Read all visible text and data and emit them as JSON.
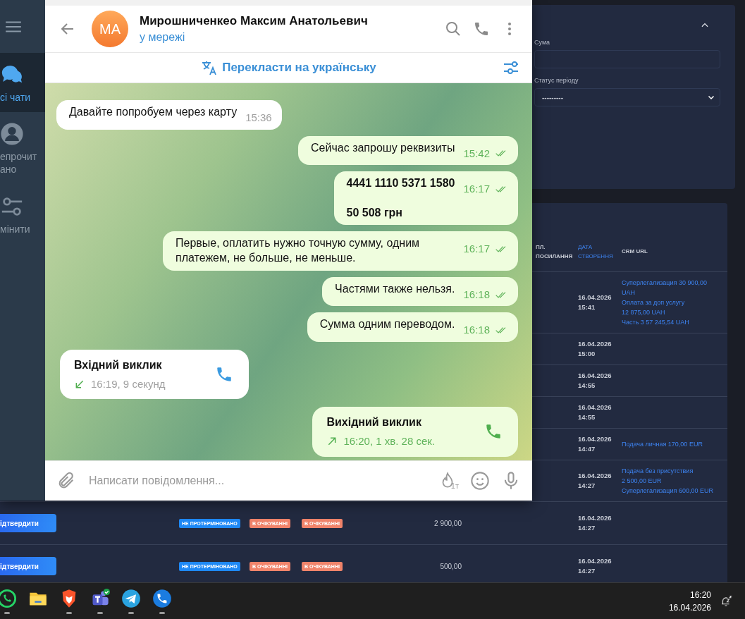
{
  "telegram": {
    "folders": [
      {
        "kind": "chats",
        "label": "сі чати",
        "selected": true
      },
      {
        "kind": "unread",
        "label": "епрочитано",
        "selected": false
      },
      {
        "kind": "edit",
        "label": "мінити",
        "selected": false
      }
    ],
    "contact": {
      "initials": "MA",
      "name": "Мирошниченкео Максим Анатольевич",
      "status": "у мережі"
    },
    "translate_bar": {
      "label": "Перекласти на українську"
    },
    "messages": [
      {
        "outgoing": false,
        "kind": "text",
        "text": "Давайте попробуем через карту",
        "time": "15:36"
      },
      {
        "outgoing": true,
        "kind": "text",
        "text": "Сейчас запрошу реквизиты",
        "time": "15:42",
        "read": true
      },
      {
        "outgoing": true,
        "kind": "text",
        "bold": true,
        "text": "4441 1110 5371 1580\n\n50 508 грн",
        "time": "16:17",
        "read": true
      },
      {
        "outgoing": true,
        "kind": "text",
        "text": "Первые, оплатить нужно точную сумму, одним платежем, не больше, не меньше.",
        "time": "16:17",
        "read": true
      },
      {
        "outgoing": true,
        "kind": "text",
        "text": "Частями также нельзя.",
        "time": "16:18",
        "read": true
      },
      {
        "outgoing": true,
        "kind": "text",
        "text": "Сумма одним переводом.",
        "time": "16:18",
        "read": true
      },
      {
        "outgoing": false,
        "kind": "call",
        "title": "Вхідний виклик",
        "detail": "16:19, 9 секунд"
      },
      {
        "outgoing": true,
        "kind": "call",
        "title": "Вихідний виклик",
        "detail": "16:20, 1 хв. 28 сек."
      }
    ],
    "composer": {
      "placeholder": "Написати повідомлення...",
      "timer": "1т"
    }
  },
  "web_app": {
    "filters": [
      {
        "kind": "input",
        "label": "Сума"
      },
      {
        "kind": "select",
        "label": "Статус періоду",
        "value": "---------"
      }
    ],
    "table": {
      "columns": [
        {
          "label": "ПЛ. ПОСИЛАННЯ",
          "sorted": false
        },
        {
          "label": "ДАТА СТВОРЕННЯ",
          "sorted": true
        },
        {
          "label": "CRM URL",
          "sorted": false
        }
      ],
      "rows": [
        {
          "date": "16.04.2026",
          "time": "15:41",
          "crm": [
            "Суперлегализация 30 900,00",
            "UAH",
            "Оплата за доп услугу",
            "12 875,00 UAH",
            "Часть 3 57 245,54 UAH"
          ]
        },
        {
          "date": "16.04.2026",
          "time": "15:00"
        },
        {
          "date": "16.04.2026",
          "time": "14:55"
        },
        {
          "date": "16.04.2026",
          "time": "14:55"
        },
        {
          "date": "16.04.2026",
          "time": "14:47",
          "crm": [
            "Подача личная 170,00 EUR"
          ]
        },
        {
          "date": "16.04.2026",
          "time": "14:27",
          "crm": [
            "Подача без присутствия",
            "2 500,00 EUR",
            "Суперлегализация 600,00 EUR"
          ]
        },
        {
          "action": "ідтвердити",
          "badges": [
            {
              "label": "НЕ ПРОТЕРМІНОВАНО",
              "color": "#1e88f5"
            },
            {
              "label": "В ОЧІКУВАННІ",
              "color": "#f0836a"
            },
            {
              "label": "В ОЧІКУВАННІ",
              "color": "#f0836a"
            }
          ],
          "amount": "2 900,00",
          "date": "16.04.2026",
          "time": "14:27"
        },
        {
          "action": "ідтвердити",
          "badges": [
            {
              "label": "НЕ ПРОТЕРМІНОВАНО",
              "color": "#1e88f5"
            },
            {
              "label": "В ОЧІКУВАННІ",
              "color": "#f0836a"
            },
            {
              "label": "В ОЧІКУВАННІ",
              "color": "#f0836a"
            }
          ],
          "amount": "500,00",
          "date": "16.04.2026",
          "time": "14:27"
        }
      ]
    }
  },
  "taskbar": {
    "apps": [
      {
        "kind": "chat",
        "running": true
      },
      {
        "kind": "folder",
        "running": false
      },
      {
        "kind": "lion",
        "running": true
      },
      {
        "kind": "team",
        "running": true
      },
      {
        "kind": "plane",
        "running": true
      },
      {
        "kind": "phone",
        "running": true
      }
    ],
    "time": "16:20",
    "date": "16.04.2026"
  }
}
